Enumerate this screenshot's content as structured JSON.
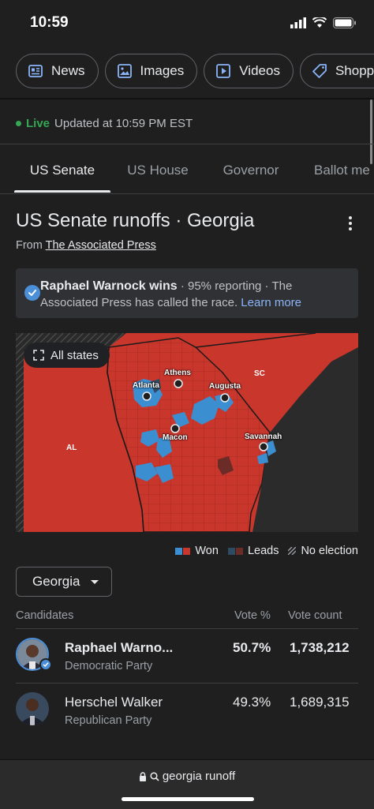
{
  "status_bar": {
    "time": "10:59"
  },
  "chips": [
    {
      "label": "News",
      "icon": "news-icon"
    },
    {
      "label": "Images",
      "icon": "image-icon"
    },
    {
      "label": "Videos",
      "icon": "video-icon"
    },
    {
      "label": "Shopping",
      "icon": "tag-icon"
    }
  ],
  "live": {
    "label": "Live",
    "updated": "Updated at 10:59 PM EST"
  },
  "tabs": [
    "US Senate",
    "US House",
    "Governor",
    "Ballot me"
  ],
  "header": {
    "title": "US Senate runoffs · Georgia",
    "from_prefix": "From ",
    "source": "The Associated Press"
  },
  "callout": {
    "winner_text": "Raphael Warnock wins",
    "details": " · 95% reporting · The Associated Press has called the race. ",
    "learn_more": "Learn more"
  },
  "map": {
    "all_states_label": "All states",
    "state_labels": [
      "SC",
      "AL"
    ],
    "city_labels": [
      "Athens",
      "Atlanta",
      "Augusta",
      "Macon",
      "Savannah"
    ]
  },
  "legend": {
    "won": "Won",
    "leads": "Leads",
    "no_election": "No election"
  },
  "dropdown": {
    "selected": "Georgia"
  },
  "table": {
    "headers": {
      "candidates": "Candidates",
      "vote_pct": "Vote %",
      "vote_count": "Vote count"
    },
    "rows": [
      {
        "name": "Raphael Warno...",
        "party": "Democratic Party",
        "pct": "50.7%",
        "count": "1,738,212",
        "winner": true
      },
      {
        "name": "Herschel Walker",
        "party": "Republican Party",
        "pct": "49.3%",
        "count": "1,689,315",
        "winner": false
      }
    ]
  },
  "url_bar": {
    "text": "georgia runoff"
  },
  "colors": {
    "dem": "#3b8ed0",
    "rep": "#c9362c",
    "dem_leads": "#2f4a63",
    "rep_leads": "#6b2b26",
    "accent_blue": "#8ab4f8",
    "live_green": "#34a853"
  }
}
